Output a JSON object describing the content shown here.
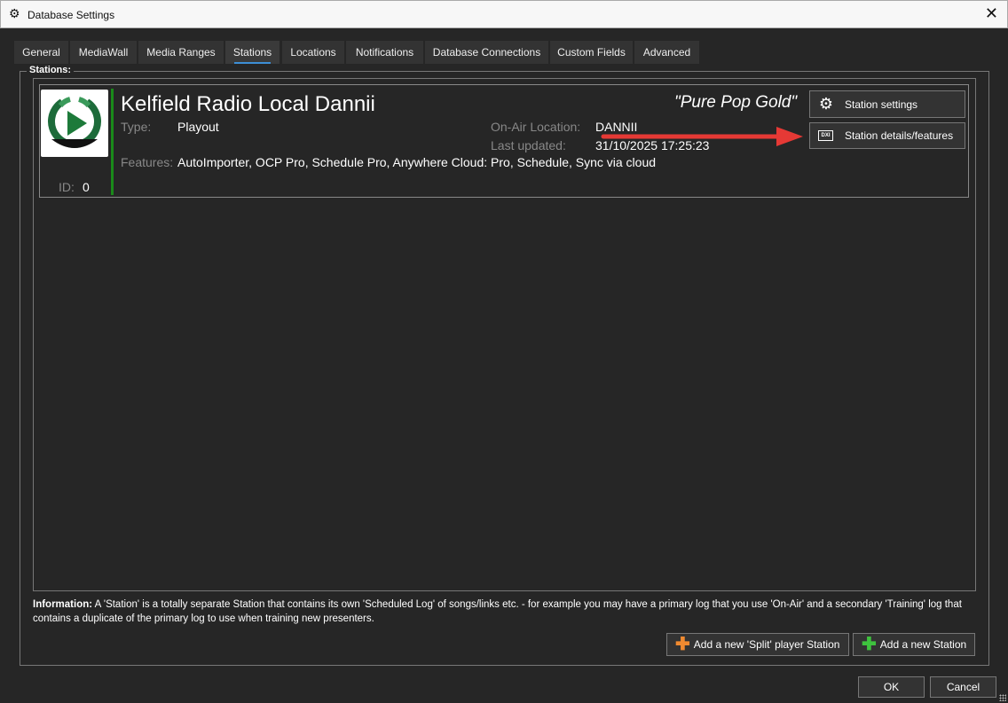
{
  "window": {
    "title": "Database Settings",
    "close": "✕"
  },
  "tabs": [
    {
      "label": "General"
    },
    {
      "label": "MediaWall"
    },
    {
      "label": "Media Ranges"
    },
    {
      "label": "Stations",
      "selected": true
    },
    {
      "label": "Locations"
    },
    {
      "label": "Notifications"
    },
    {
      "label": "Database Connections"
    },
    {
      "label": "Custom Fields"
    },
    {
      "label": "Advanced"
    }
  ],
  "group_label": "Stations:",
  "station": {
    "name": "Kelfield Radio Local Dannii",
    "slogan": "\"Pure Pop Gold\"",
    "type_label": "Type:",
    "type": "Playout",
    "onair_label": "On-Air Location:",
    "onair": "DANNII",
    "updated_label": "Last updated:",
    "updated": "31/10/2025 17:25:23",
    "features_label": "Features:",
    "features": "AutoImporter, OCP Pro, Schedule Pro, Anywhere Cloud: Pro, Schedule, Sync via cloud",
    "id_label": "ID:",
    "id": "0",
    "settings_button": "Station settings",
    "details_button": "Station details/features",
    "details_icon_text": "DXI"
  },
  "info": {
    "bold": "Information:",
    "text": " A 'Station' is a totally separate Station that contains its own 'Scheduled Log' of songs/links etc. - for example you may have a primary log that you use 'On-Air' and a secondary 'Training' log that contains a duplicate of the primary log to use when training new presenters."
  },
  "buttons": {
    "add_split": "Add a new 'Split' player Station",
    "add_station": "Add a new Station",
    "ok": "OK",
    "cancel": "Cancel"
  },
  "colors": {
    "accent": "#3d8fd6",
    "station_bar": "#1a8a1a",
    "annotation_arrow": "#e53935"
  }
}
